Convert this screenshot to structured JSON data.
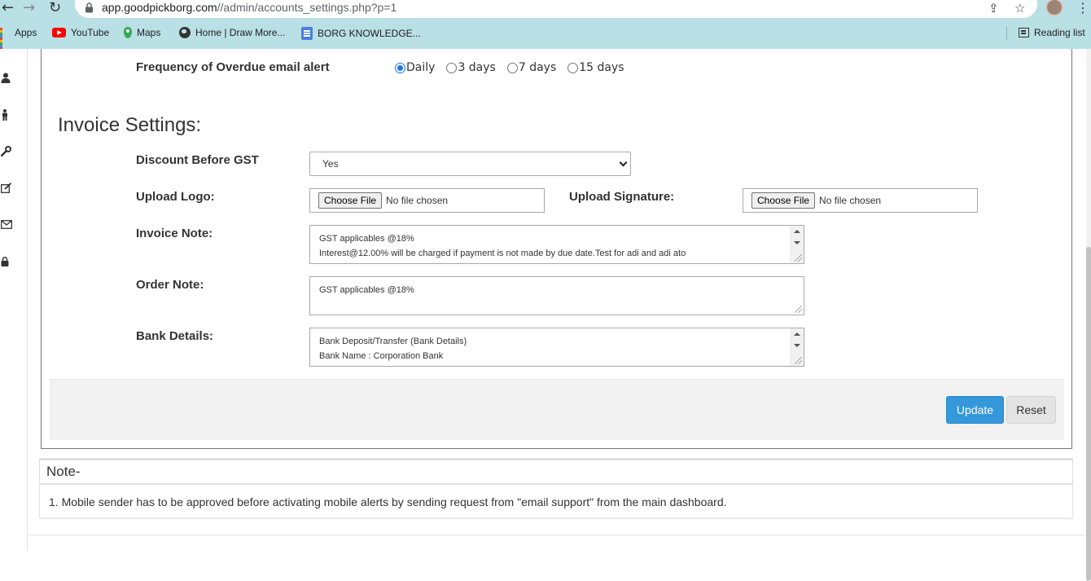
{
  "browser": {
    "url_host": "app.goodpickborg.com",
    "url_path": "//admin/accounts_settings.php?p=1",
    "bookmarks": [
      {
        "label": "Apps",
        "icon": "apps-icon"
      },
      {
        "label": "YouTube",
        "icon": "youtube-icon"
      },
      {
        "label": "Maps",
        "icon": "maps-icon"
      },
      {
        "label": "Home | Draw More...",
        "icon": "globe-icon"
      },
      {
        "label": "BORG KNOWLEDGE...",
        "icon": "doc-icon"
      }
    ],
    "reading_list": "Reading list"
  },
  "sidebar": {
    "icons": [
      "user-icon",
      "male-icon",
      "wrench-icon",
      "edit-icon",
      "envelope-icon",
      "lock-icon"
    ]
  },
  "alerts": {
    "frequency_label": "Frequency of Overdue email alert",
    "options": [
      "Daily",
      "3 days",
      "7 days",
      "15 days"
    ],
    "selected": "Daily"
  },
  "invoice": {
    "title": "Invoice Settings:",
    "discount_label": "Discount Before GST",
    "discount_value": "Yes",
    "logo_label": "Upload Logo:",
    "signature_label": "Upload Signature:",
    "choose_file": "Choose File",
    "no_file": "No file chosen",
    "invoice_note_label": "Invoice Note:",
    "invoice_note_lines": [
      "GST applicables @18%",
      "Interest@12.00% will be charged if payment is not made by due date.Test for adi and adi ato"
    ],
    "order_note_label": "Order Note:",
    "order_note_value": "GST applicables @18%",
    "bank_label": "Bank Details:",
    "bank_lines": [
      "Bank Deposit/Transfer (Bank Details)",
      "Bank Name : Corporation Bank"
    ]
  },
  "actions": {
    "update": "Update",
    "reset": "Reset"
  },
  "note": {
    "title": "Note-",
    "text": "1. Mobile sender has to be approved before activating mobile alerts by sending request from \"email support\" from the main dashboard."
  }
}
